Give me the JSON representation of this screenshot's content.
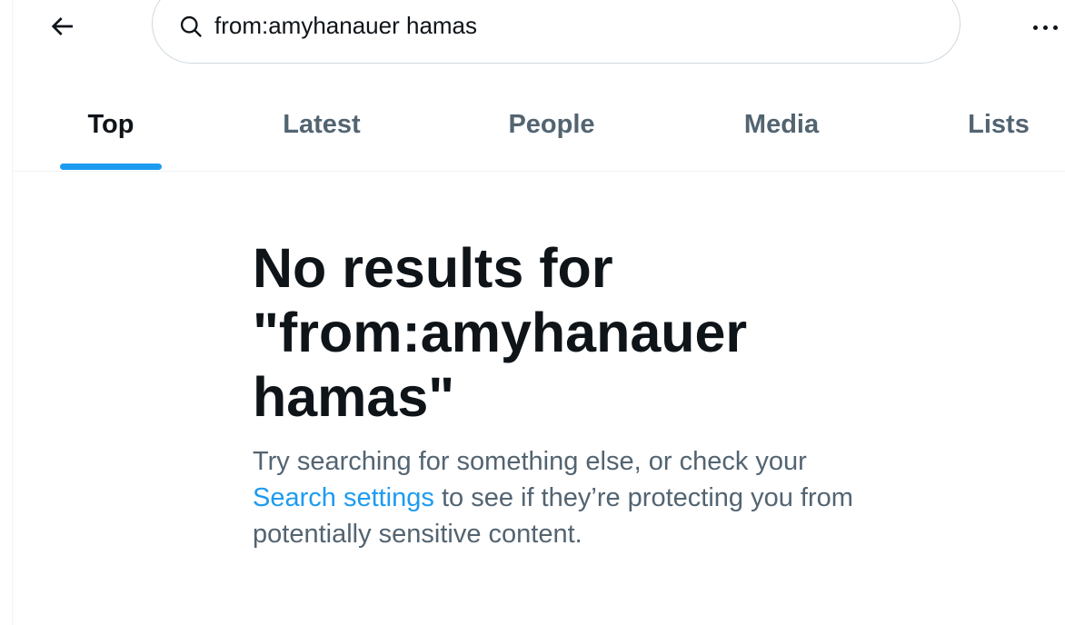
{
  "header": {
    "back_icon": "arrow-left-icon",
    "search_icon": "search-icon",
    "search_value": "from:amyhanauer hamas",
    "more_icon": "more-horizontal-icon"
  },
  "tabs": [
    {
      "label": "Top",
      "active": true
    },
    {
      "label": "Latest",
      "active": false
    },
    {
      "label": "People",
      "active": false
    },
    {
      "label": "Media",
      "active": false
    },
    {
      "label": "Lists",
      "active": false
    }
  ],
  "empty_state": {
    "title": "No results for \"from:amyhanauer hamas\"",
    "desc_before": "Try searching for something else, or check your ",
    "link": "Search settings",
    "desc_after": " to see if they’re protecting you from potentially sensitive content."
  },
  "colors": {
    "accent": "#1d9bf0",
    "primary_text": "#0f1419",
    "secondary_text": "#536471",
    "border": "#cfd9de"
  }
}
